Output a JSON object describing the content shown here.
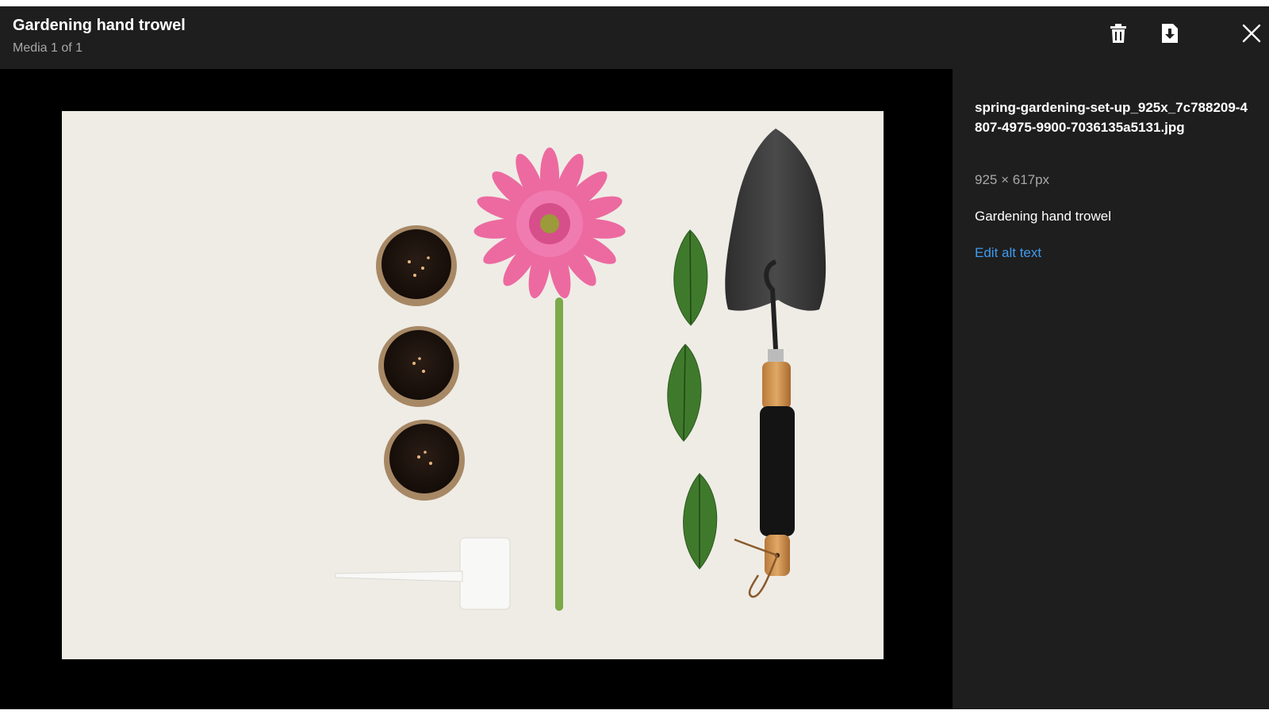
{
  "header": {
    "title": "Gardening hand trowel",
    "subtitle": "Media 1 of 1"
  },
  "icons": {
    "delete": "trash-icon",
    "download": "download-icon",
    "close": "close-icon"
  },
  "media": {
    "alt": "Gardening hand trowel",
    "description": "Photo of spring gardening set up: three peat pots with soil and seeds, a pink gerbera flower, three green leaves, a plant label and a black hand trowel with wooden handle on a white textured background"
  },
  "details": {
    "filename": "spring-gardening-set-up_925x_7c788209-4807-4975-9900-7036135a5131.jpg",
    "dimensions": "925 × 617px",
    "alt_text": "Gardening hand trowel",
    "edit_link": "Edit alt text"
  },
  "colors": {
    "header_bg": "#1e1e1e",
    "stage_bg": "#000000",
    "link": "#3d9bf0",
    "muted": "#a8a8a8"
  }
}
